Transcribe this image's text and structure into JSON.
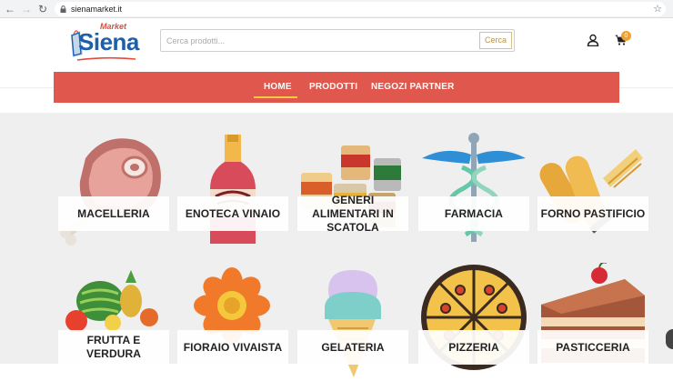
{
  "browser": {
    "url": "sienamarket.it"
  },
  "header": {
    "logo_market": "Market",
    "logo_siena": "Siena",
    "search_placeholder": "Cerca prodotti...",
    "search_button": "Cerca",
    "cart_count": "0"
  },
  "menu": {
    "items": [
      {
        "label": "HOME"
      },
      {
        "label": "PRODOTTI"
      },
      {
        "label": "NEGOZI PARTNER"
      }
    ]
  },
  "categories": [
    {
      "label": "MACELLERIA",
      "icon": "ham-icon"
    },
    {
      "label": "ENOTECA VINAIO",
      "icon": "wine-bottle-icon"
    },
    {
      "label": "GENERI ALIMENTARI IN SCATOLA",
      "icon": "canned-food-icon"
    },
    {
      "label": "FARMACIA",
      "icon": "caduceus-icon"
    },
    {
      "label": "FORNO PASTIFICIO",
      "icon": "bread-icon"
    },
    {
      "label": "FRUTTA E VERDURA",
      "icon": "fruit-basket-icon"
    },
    {
      "label": "FIORAIO VIVAISTA",
      "icon": "flower-icon"
    },
    {
      "label": "GELATERIA",
      "icon": "ice-cream-icon"
    },
    {
      "label": "PIZZERIA",
      "icon": "pizza-icon"
    },
    {
      "label": "PASTICCERIA",
      "icon": "cake-icon"
    }
  ]
}
